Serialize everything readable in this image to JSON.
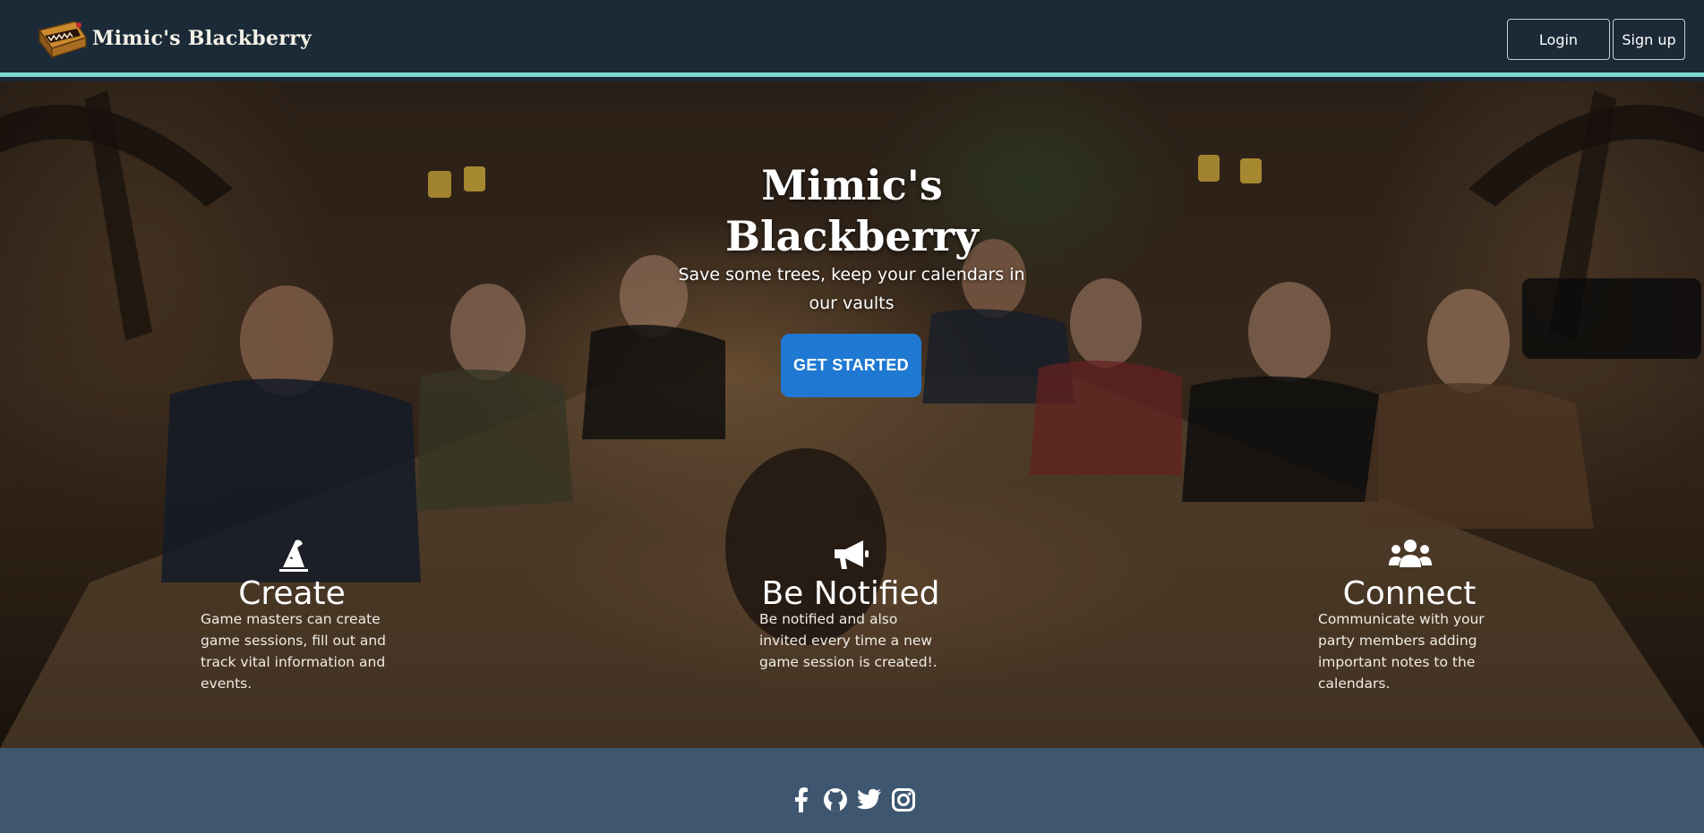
{
  "navbar": {
    "brand": "Mimic's Blackberry",
    "brand_logo_icon": "treasure-chest-mimic-icon",
    "login_label": "Login",
    "signup_label": "Sign up",
    "accent_color": "#7fd8cf"
  },
  "hero": {
    "title_line1": "Mimic's",
    "title_line2": "Blackberry",
    "subtitle": "Save some trees, keep your calendars in our vaults",
    "cta_label": "GET STARTED",
    "cta_color": "#1f78d1"
  },
  "features": [
    {
      "icon": "wizard-hat-icon",
      "title": "Create",
      "description": "Game masters can create game sessions, fill out and track vital information and events."
    },
    {
      "icon": "megaphone-icon",
      "title": "Be Notified",
      "description": "Be notified and also invited every time a new game session is created!."
    },
    {
      "icon": "users-icon",
      "title": "Connect",
      "description": "Communicate with your party members adding important notes to the calendars."
    }
  ],
  "footer": {
    "social": [
      "facebook-icon",
      "github-icon",
      "twitter-icon",
      "instagram-icon"
    ],
    "background": "#3e5670"
  }
}
